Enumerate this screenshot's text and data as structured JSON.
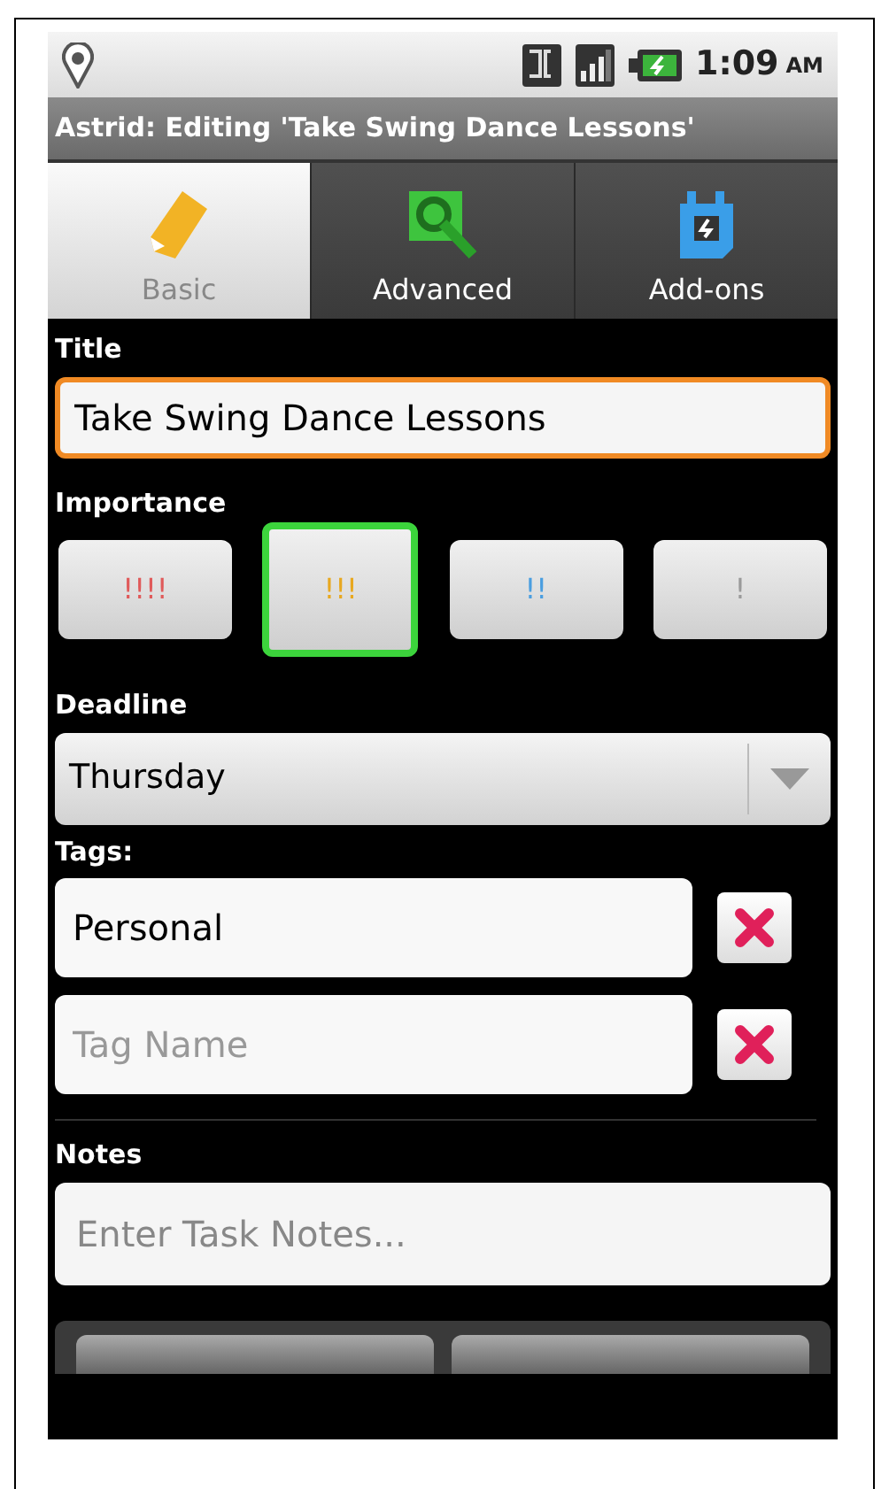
{
  "status_bar": {
    "time": "1:09",
    "ampm": "AM"
  },
  "window": {
    "title": "Astrid: Editing 'Take Swing Dance Lessons'"
  },
  "tabs": [
    {
      "label": "Basic",
      "selected": true
    },
    {
      "label": "Advanced",
      "selected": false
    },
    {
      "label": "Add-ons",
      "selected": false
    }
  ],
  "title_section": {
    "label": "Title",
    "value": "Take Swing Dance Lessons"
  },
  "importance": {
    "label": "Importance",
    "options": [
      {
        "label": "!!!!",
        "color": "#e05a5a",
        "selected": false
      },
      {
        "label": "!!!",
        "color": "#e8a820",
        "selected": true
      },
      {
        "label": "!!",
        "color": "#4a9ee0",
        "selected": false
      },
      {
        "label": "!",
        "color": "#9a9a9a",
        "selected": false
      }
    ]
  },
  "deadline": {
    "label": "Deadline",
    "value": "Thursday"
  },
  "tags": {
    "label": "Tags:",
    "items": [
      {
        "value": "Personal"
      },
      {
        "placeholder": "Tag Name"
      }
    ]
  },
  "notes": {
    "label": "Notes",
    "placeholder": "Enter Task Notes..."
  }
}
